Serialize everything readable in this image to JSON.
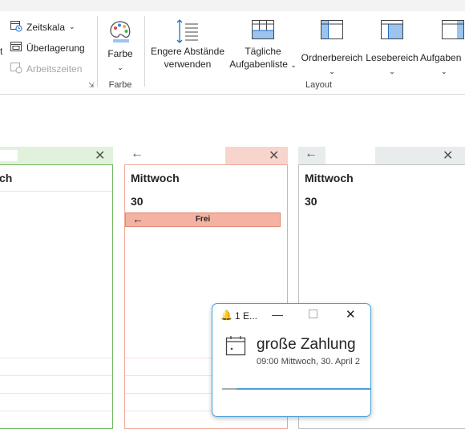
{
  "ribbon": {
    "timescale_label": "Zeitskala",
    "overlay_label": "Überlagerung",
    "workhours_label": "Arbeitszeiten",
    "left_edge_char": "t",
    "color_button_label": "Farbe",
    "color_group_label": "Farbe",
    "compact_label_1": "Engere Abstände",
    "compact_label_2": "verwenden",
    "daily_tasks_label_1": "Tägliche",
    "daily_tasks_label_2": "Aufgabenliste",
    "folder_pane_label": "Ordnerbereich",
    "reading_pane_label": "Lesebereich",
    "task_pane_label": "Aufgaben",
    "layout_group_label": "Layout"
  },
  "calendars": [
    {
      "day_name": "ch",
      "accent": "#70b860",
      "header_bg": "#e2f1dc"
    },
    {
      "day_name": "Mittwoch",
      "day_number": "30",
      "accent": "#f0a898",
      "header_bg": "#f7d4cc",
      "event_label": "Frei"
    },
    {
      "day_name": "Mittwoch",
      "day_number": "30",
      "accent": "#c0c0c0",
      "header_bg": "#e8ecec"
    }
  ],
  "reminder": {
    "title": "1 E...",
    "event_title": "große Zahlung",
    "event_time": "09:00 Mittwoch, 30. April 2",
    "accent": "#4a9fd8"
  }
}
